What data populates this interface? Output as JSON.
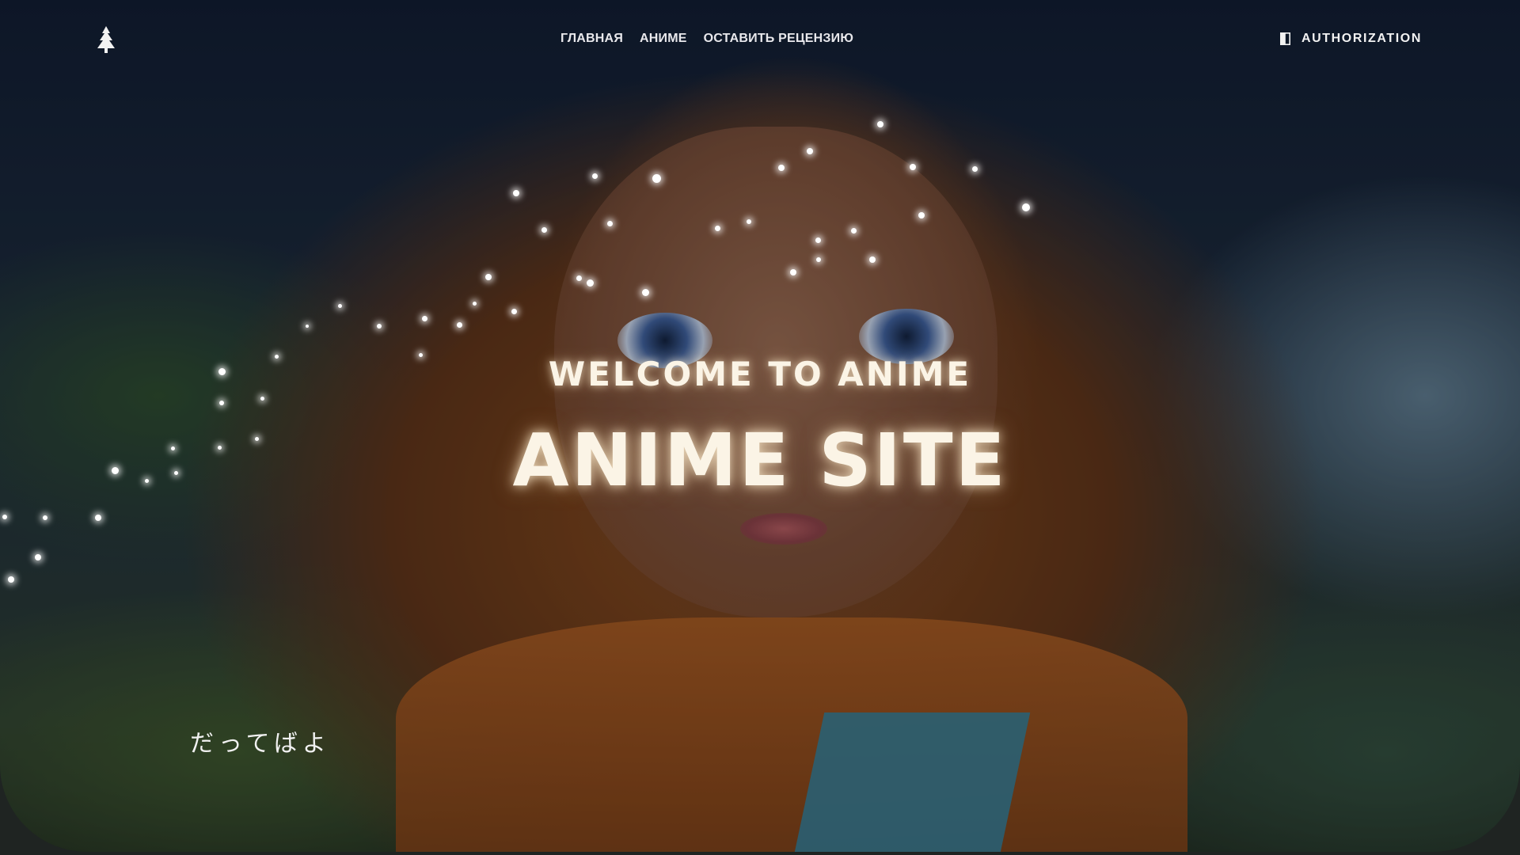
{
  "nav": {
    "items": [
      {
        "label": "ГЛАВНАЯ"
      },
      {
        "label": "АНИМЕ"
      },
      {
        "label": "ОСТАВИТЬ РЕЦЕНЗИЮ"
      }
    ],
    "logo_icon": "tree-icon",
    "auth_icon": "door-icon",
    "auth_label": "AUTHORIZATION"
  },
  "hero": {
    "welcome": "WELCOME TO ANIME",
    "title": "ANIME SITE",
    "tagline": "だってばよ"
  },
  "colors": {
    "text": "#ffffff",
    "accent_hair": "#c8641e",
    "background_dark": "#1f2422"
  }
}
